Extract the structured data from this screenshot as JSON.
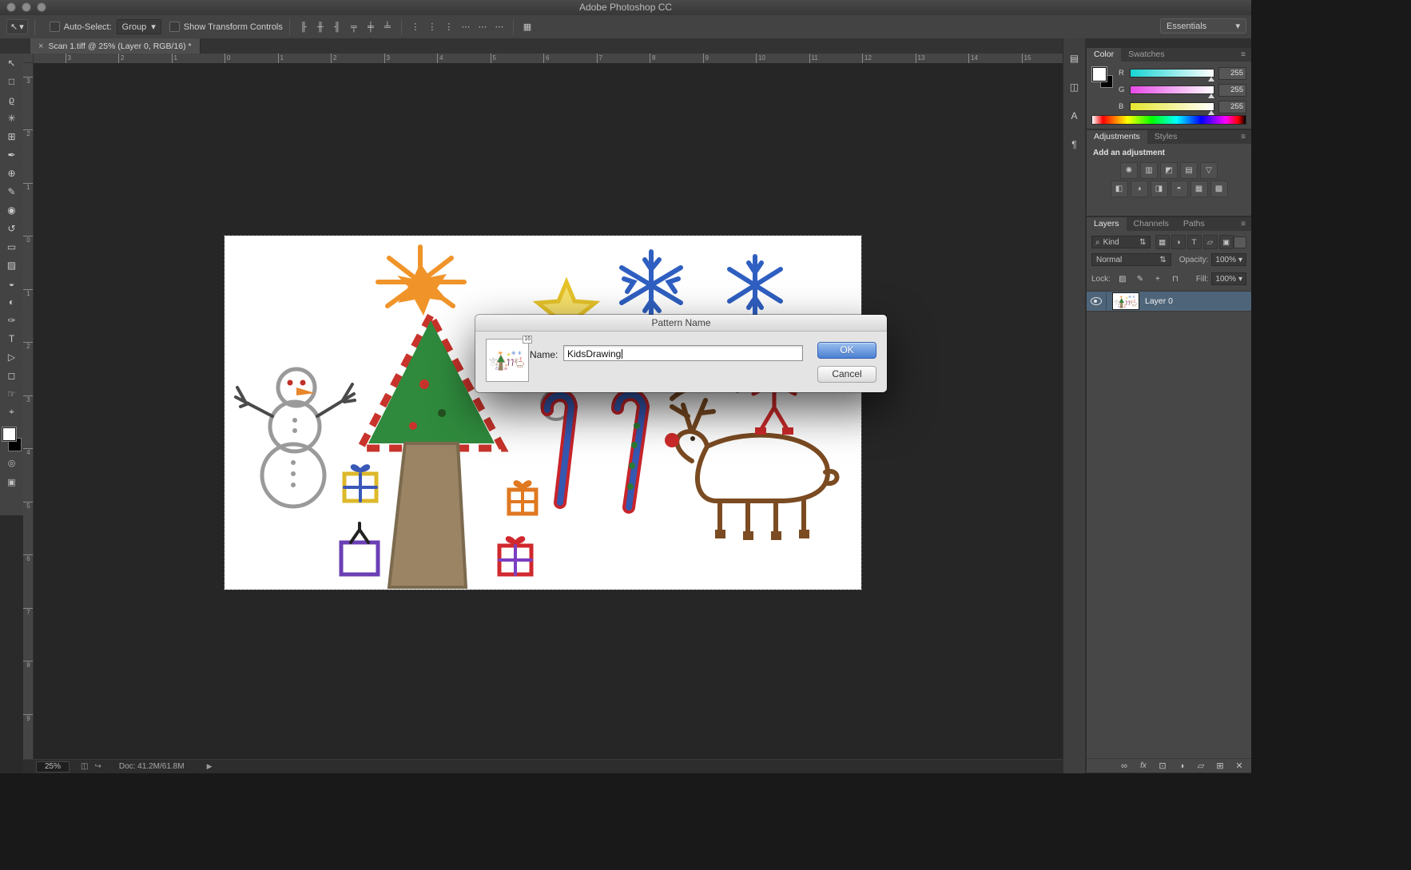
{
  "window": {
    "title": "Adobe Photoshop CC",
    "traffic_lights": [
      {
        "name": "close-button"
      },
      {
        "name": "minimize-button"
      },
      {
        "name": "zoom-button"
      }
    ]
  },
  "icons": {
    "chevron_down": "▾",
    "updown": "⇅",
    "menu": "≡",
    "flyout": "▶",
    "close": "×",
    "magnifier": "⌕",
    "tool_move": "↖"
  },
  "options_bar": {
    "auto_select_label": "Auto-Select:",
    "group_value": "Group",
    "show_transform_label": "Show Transform Controls",
    "workspace_value": "Essentials",
    "align_icons": [
      {
        "name": "align-left-edges-icon",
        "glyph": "╟"
      },
      {
        "name": "align-horizontal-centers-icon",
        "glyph": "╫"
      },
      {
        "name": "align-right-edges-icon",
        "glyph": "╢"
      },
      {
        "name": "align-top-edges-icon",
        "glyph": "╤"
      },
      {
        "name": "align-vertical-centers-icon",
        "glyph": "╪"
      },
      {
        "name": "align-bottom-edges-icon",
        "glyph": "╧"
      }
    ],
    "distribute_icons": [
      {
        "name": "distribute-top-edges-icon",
        "glyph": "⋮"
      },
      {
        "name": "distribute-vertical-centers-icon",
        "glyph": "⋮"
      },
      {
        "name": "distribute-bottom-edges-icon",
        "glyph": "⋮"
      },
      {
        "name": "distribute-left-edges-icon",
        "glyph": "⋯"
      },
      {
        "name": "distribute-horizontal-centers-icon",
        "glyph": "⋯"
      },
      {
        "name": "distribute-right-edges-icon",
        "glyph": "⋯"
      }
    ],
    "auto_align_icon": {
      "name": "auto-align-layers-icon",
      "glyph": "▦"
    }
  },
  "document_tab": {
    "title": "Scan 1.tiff @ 25% (Layer 0, RGB/16) *"
  },
  "toolbar": {
    "tools": [
      {
        "name": "move-tool",
        "glyph": "↖"
      },
      {
        "name": "rectangular-marquee-tool",
        "glyph": "□"
      },
      {
        "name": "lasso-tool",
        "glyph": "ϱ"
      },
      {
        "name": "quick-selection-tool",
        "glyph": "✳"
      },
      {
        "name": "crop-tool",
        "glyph": "⊞"
      },
      {
        "name": "eyedropper-tool",
        "glyph": "✒"
      },
      {
        "name": "healing-brush-tool",
        "glyph": "⊕"
      },
      {
        "name": "brush-tool",
        "glyph": "✎"
      },
      {
        "name": "clone-stamp-tool",
        "glyph": "◉"
      },
      {
        "name": "history-brush-tool",
        "glyph": "↺"
      },
      {
        "name": "eraser-tool",
        "glyph": "▭"
      },
      {
        "name": "gradient-tool",
        "glyph": "▨"
      },
      {
        "name": "blur-tool",
        "glyph": "◒"
      },
      {
        "name": "dodge-tool",
        "glyph": "◐"
      },
      {
        "name": "pen-tool",
        "glyph": "✑"
      },
      {
        "name": "type-tool",
        "glyph": "T"
      },
      {
        "name": "path-selection-tool",
        "glyph": "▷"
      },
      {
        "name": "shape-tool",
        "glyph": "◻"
      },
      {
        "name": "hand-tool",
        "glyph": "☞"
      },
      {
        "name": "zoom-tool",
        "glyph": "⌖"
      }
    ]
  },
  "rulers": {
    "top_labels": [
      "3",
      "2",
      "1",
      "0",
      "1",
      "2",
      "3",
      "4",
      "5",
      "6",
      "7",
      "8",
      "9",
      "10",
      "11",
      "12",
      "13",
      "14",
      "15"
    ],
    "left_labels": [
      "3",
      "2",
      "1",
      "0",
      "1",
      "2",
      "3",
      "4",
      "5",
      "6",
      "7",
      "8",
      "9"
    ]
  },
  "dialog": {
    "title": "Pattern Name",
    "bit_depth_badge": "16",
    "name_label": "Name:",
    "name_value": "KidsDrawing",
    "ok_label": "OK",
    "cancel_label": "Cancel"
  },
  "panels": {
    "dock_icons": [
      {
        "name": "history-panel-icon",
        "glyph": "▤"
      },
      {
        "name": "properties-panel-icon",
        "glyph": "◫"
      },
      {
        "name": "character-panel-icon",
        "glyph": "A"
      },
      {
        "name": "paragraph-panel-icon",
        "glyph": "¶"
      }
    ],
    "color": {
      "tabs": [
        "Color",
        "Swatches"
      ],
      "channels": [
        {
          "name": "channel-r",
          "label": "R",
          "value": "255"
        },
        {
          "name": "channel-g",
          "label": "G",
          "value": "255"
        },
        {
          "name": "channel-b",
          "label": "B",
          "value": "255"
        }
      ]
    },
    "adjustments": {
      "tabs": [
        "Adjustments",
        "Styles"
      ],
      "header": "Add an adjustment",
      "icons_row1": [
        {
          "name": "brightness-contrast-adjustment-icon",
          "glyph": "✺"
        },
        {
          "name": "levels-adjustment-icon",
          "glyph": "▥"
        },
        {
          "name": "curves-adjustment-icon",
          "glyph": "◩"
        },
        {
          "name": "exposure-adjustment-icon",
          "glyph": "▤"
        },
        {
          "name": "vibrance-adjustment-icon",
          "glyph": "▽"
        }
      ],
      "icons_row2": [
        {
          "name": "hue-saturation-adjustment-icon",
          "glyph": "◧"
        },
        {
          "name": "color-balance-adjustment-icon",
          "glyph": "◑"
        },
        {
          "name": "black-white-adjustment-icon",
          "glyph": "◨"
        },
        {
          "name": "photo-filter-adjustment-icon",
          "glyph": "◓"
        },
        {
          "name": "channel-mixer-adjustment-icon",
          "glyph": "▦"
        },
        {
          "name": "color-lookup-adjustment-icon",
          "glyph": "▩"
        }
      ]
    },
    "layers": {
      "tabs": [
        "Layers",
        "Channels",
        "Paths"
      ],
      "filter_label": "Kind",
      "filter_icons": [
        {
          "name": "filter-pixel-layers-icon",
          "glyph": "▦"
        },
        {
          "name": "filter-adjustment-layers-icon",
          "glyph": "◑"
        },
        {
          "name": "filter-type-layers-icon",
          "glyph": "T"
        },
        {
          "name": "filter-shape-layers-icon",
          "glyph": "▱"
        },
        {
          "name": "filter-smart-objects-icon",
          "glyph": "▣"
        }
      ],
      "blend_mode": "Normal",
      "opacity_label": "Opacity:",
      "opacity_value": "100%",
      "lock_label": "Lock:",
      "lock_icons": [
        {
          "name": "lock-transparent-pixels-icon",
          "glyph": "▨"
        },
        {
          "name": "lock-image-pixels-icon",
          "glyph": "✎"
        },
        {
          "name": "lock-position-icon",
          "glyph": "+"
        },
        {
          "name": "lock-all-icon",
          "glyph": "⊓"
        }
      ],
      "fill_label": "Fill:",
      "fill_value": "100%",
      "layer_name": "Layer 0",
      "bottom_icons": [
        {
          "name": "link-layers-icon",
          "glyph": "∞"
        },
        {
          "name": "layer-effects-icon",
          "glyph": "fx"
        },
        {
          "name": "add-layer-mask-icon",
          "glyph": "⊡"
        },
        {
          "name": "new-adjustment-layer-icon",
          "glyph": "◑"
        },
        {
          "name": "new-group-icon",
          "glyph": "▱"
        },
        {
          "name": "new-layer-icon",
          "glyph": "⊞"
        },
        {
          "name": "delete-layer-icon",
          "glyph": "✕"
        }
      ]
    }
  },
  "status_bar": {
    "zoom": "25%",
    "doc_label": "Doc: 41.2M/61.8M",
    "icons": [
      {
        "name": "status-doc-icon",
        "glyph": "◫"
      },
      {
        "name": "status-share-icon",
        "glyph": "↪"
      }
    ]
  },
  "colors": {
    "accent_blue": "#4a7fd0",
    "layer_selected_bg": "#4e6579",
    "traffic_light": "#8b8b8b"
  }
}
